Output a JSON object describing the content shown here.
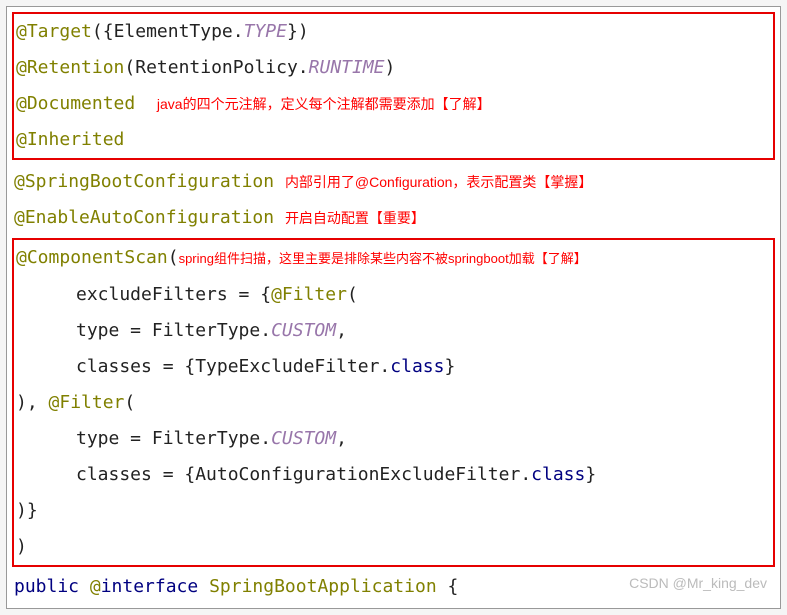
{
  "box1": {
    "line1": {
      "at": "@",
      "anno": "Target",
      "open": "({",
      "cls": "ElementType",
      "dot": ".",
      "val": "TYPE",
      "close": "})"
    },
    "line2": {
      "at": "@",
      "anno": "Retention",
      "open": "(",
      "cls": "RetentionPolicy",
      "dot": ".",
      "val": "RUNTIME",
      "close": ")"
    },
    "line3": {
      "at": "@",
      "anno": "Documented",
      "note": "java的四个元注解，定义每个注解都需要添加【了解】"
    },
    "line4": {
      "at": "@",
      "anno": "Inherited"
    }
  },
  "mid": {
    "line5": {
      "at": "@",
      "anno": "SpringBootConfiguration",
      "note": "内部引用了@Configuration，表示配置类【掌握】"
    },
    "line6": {
      "at": "@",
      "anno": "EnableAutoConfiguration",
      "note": "开启自动配置【重要】"
    }
  },
  "box2": {
    "line7": {
      "at": "@",
      "anno": "ComponentScan",
      "open": "(",
      "note": "spring组件扫描，这里主要是排除某些内容不被springboot加载【了解】"
    },
    "line8": {
      "lhs": "excludeFilters = {",
      "at": "@",
      "anno": "Filter",
      "open": "("
    },
    "line9": {
      "lhs": "type = FilterType.",
      "val": "CUSTOM",
      "comma": ","
    },
    "line10": {
      "lhs": "classes = {TypeExcludeFilter.",
      "kw": "class",
      "close": "}"
    },
    "line11": {
      "lhs": "), ",
      "at": "@",
      "anno": "Filter",
      "open": "("
    },
    "line12": {
      "lhs": "type = FilterType.",
      "val": "CUSTOM",
      "comma": ","
    },
    "line13": {
      "lhs": "classes = {AutoConfigurationExcludeFilter.",
      "kw": "class",
      "close": "}"
    },
    "line14": {
      "txt": ")}"
    },
    "line15": {
      "txt": ")"
    }
  },
  "footer": {
    "pub": "public ",
    "at": "@",
    "iface": "interface ",
    "name": "SpringBootApplication",
    "sp": " ",
    "brace": "{"
  },
  "watermark": "CSDN @Mr_king_dev"
}
